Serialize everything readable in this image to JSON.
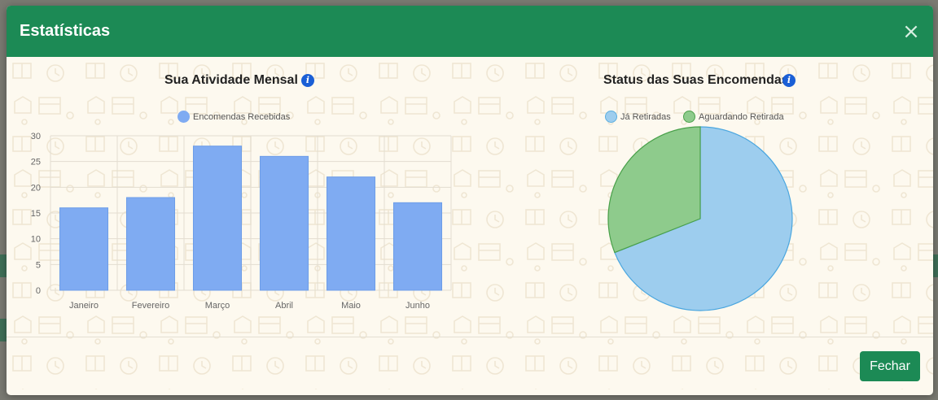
{
  "modal": {
    "title": "Estatísticas",
    "close_label": "×",
    "footer": {
      "close_button": "Fechar"
    }
  },
  "colors": {
    "header": "#1c8a55",
    "bar_fill": "#7fabf2",
    "pie_retiradas": "#9dcdee",
    "pie_aguardando": "#8ecb8c",
    "info_icon": "#1a5fd6"
  },
  "icons": [
    "info-icon",
    "close-icon"
  ],
  "bar_chart": {
    "title": "Sua Atividade Mensal",
    "chart_data": {
      "type": "bar",
      "categories": [
        "Janeiro",
        "Fevereiro",
        "Março",
        "Abril",
        "Maio",
        "Junho"
      ],
      "series": [
        {
          "name": "Encomendas Recebidas",
          "values": [
            16,
            18,
            28,
            26,
            22,
            17
          ]
        }
      ],
      "ylim": [
        0,
        30
      ],
      "yticks": [
        0,
        5,
        10,
        15,
        20,
        25,
        30
      ],
      "grid": true,
      "legend": "top"
    }
  },
  "pie_chart": {
    "title": "Status das Suas Encomendas",
    "chart_data": {
      "type": "pie",
      "labels": [
        "Já Retiradas",
        "Aguardando Retirada"
      ],
      "values": [
        69,
        31
      ],
      "legend": "top"
    }
  }
}
